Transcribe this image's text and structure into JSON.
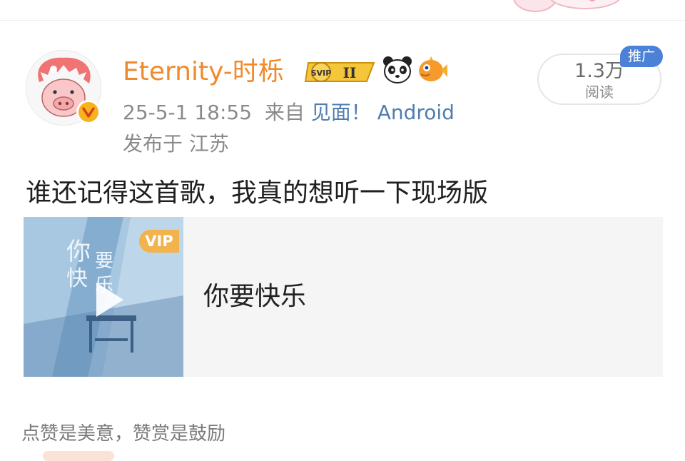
{
  "post": {
    "username": "Eternity-时栎",
    "timestamp": "25-5-1 18:55",
    "source_prefix": "来自",
    "source": "见面！ Android",
    "location": "发布于 江苏",
    "text": "谁还记得这首歌，我真的想听一下现场版"
  },
  "badges": {
    "level": "II",
    "icons": [
      "panda-icon",
      "pufferfish-icon"
    ]
  },
  "reads": {
    "count": "1.3万",
    "label": "阅读",
    "promo": "推广"
  },
  "music_card": {
    "title": "你要快乐",
    "vip": "VIP",
    "cover_text": "你要快乐"
  },
  "footer": {
    "reward_text": "点赞是美意，赞赏是鼓励"
  },
  "colors": {
    "username": "#f08a2a",
    "source_link": "#507daf",
    "promo_badge": "#4b82d8",
    "vip_badge": "#f2b24c",
    "verified_badge": "#f5b31c"
  }
}
